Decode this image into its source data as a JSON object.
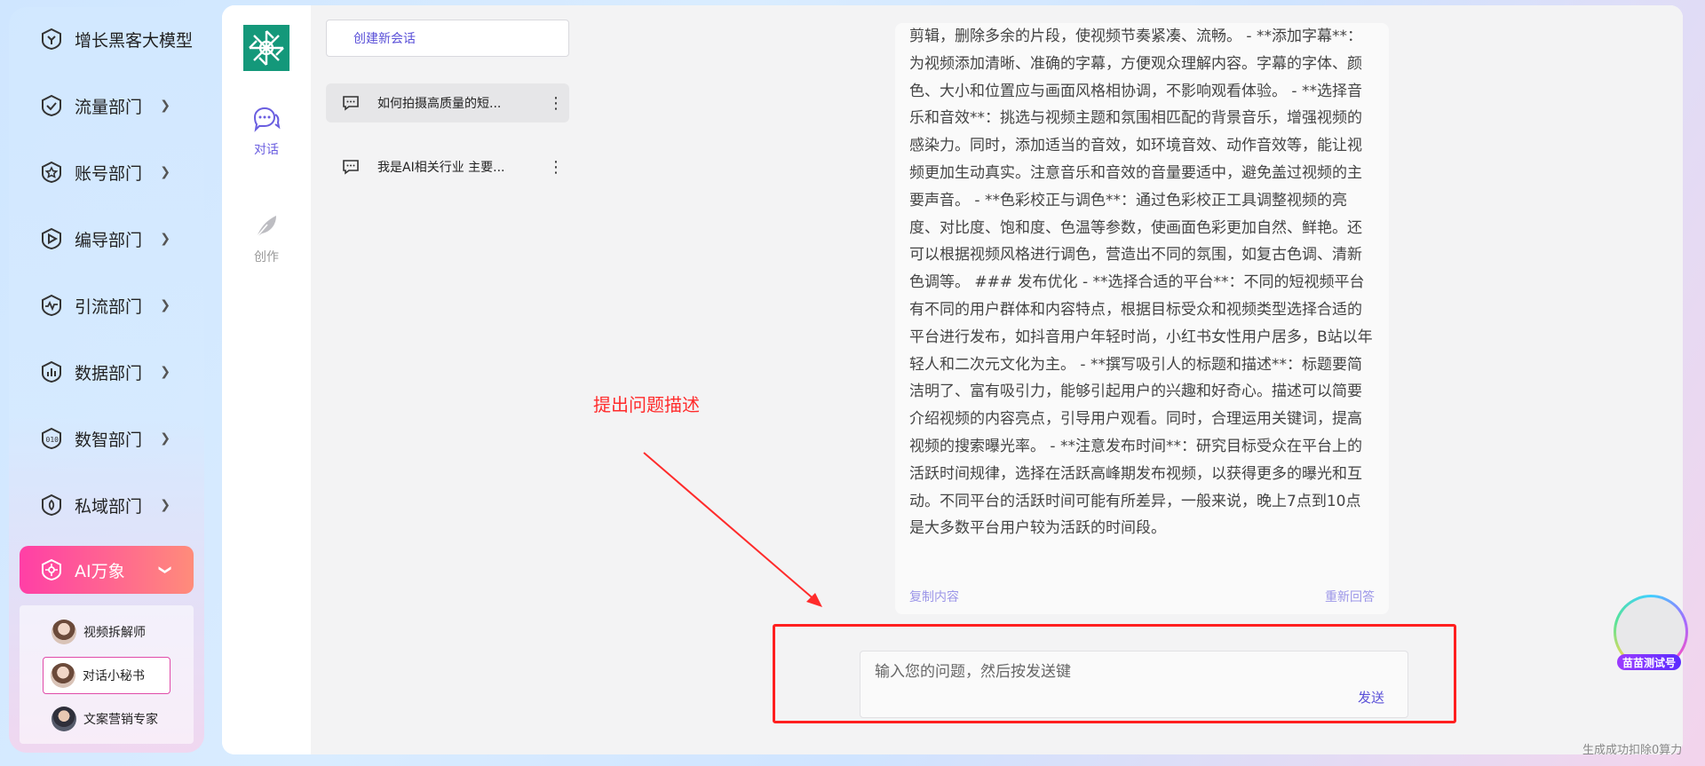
{
  "sidebar": {
    "brand": "增长黑客大模型",
    "items": [
      {
        "label": "流量部门",
        "icon": "shield-check-icon"
      },
      {
        "label": "账号部门",
        "icon": "shield-star-icon"
      },
      {
        "label": "编导部门",
        "icon": "shield-play-icon"
      },
      {
        "label": "引流部门",
        "icon": "shield-wave-icon"
      },
      {
        "label": "数据部门",
        "icon": "shield-chart-icon"
      },
      {
        "label": "数智部门",
        "icon": "shield-binary-icon"
      },
      {
        "label": "私域部门",
        "icon": "shield-lock-icon"
      }
    ],
    "active": {
      "label": "AI万象",
      "icon": "ai-flower-icon"
    },
    "subitems": [
      {
        "label": "视频拆解师"
      },
      {
        "label": "对话小秘书"
      },
      {
        "label": "文案营销专家"
      }
    ],
    "accent": "#ff3fa6"
  },
  "rail": {
    "chat": "对话",
    "create": "创作"
  },
  "sessions": {
    "new_label": "创建新会话",
    "list": [
      {
        "title": "如何拍摄高质量的短..."
      },
      {
        "title": "我是AI相关行业 主要..."
      }
    ]
  },
  "chat": {
    "answer": "剪辑，删除多余的片段，使视频节奏紧凑、流畅。 - **添加字幕**：为视频添加清晰、准确的字幕，方便观众理解内容。字幕的字体、颜色、大小和位置应与画面风格相协调，不影响观看体验。 - **选择音乐和音效**：挑选与视频主题和氛围相匹配的背景音乐，增强视频的感染力。同时，添加适当的音效，如环境音效、动作音效等，能让视频更加生动真实。注意音乐和音效的音量要适中，避免盖过视频的主要声音。 - **色彩校正与调色**：通过色彩校正工具调整视频的亮度、对比度、饱和度、色温等参数，使画面色彩更加自然、鲜艳。还可以根据视频风格进行调色，营造出不同的氛围，如复古色调、清新色调等。 ### 发布优化 - **选择合适的平台**：不同的短视频平台有不同的用户群体和内容特点，根据目标受众和视频类型选择合适的平台进行发布，如抖音用户年轻时尚，小红书女性用户居多，B站以年轻人和二次元文化为主。 - **撰写吸引人的标题和描述**：标题要简洁明了、富有吸引力，能够引起用户的兴趣和好奇心。描述可以简要介绍视频的内容亮点，引导用户观看。同时，合理运用关键词，提高视频的搜索曝光率。 - **注意发布时间**：研究目标受众在平台上的活跃时间规律，选择在活跃高峰期发布视频，以获得更多的曝光和互动。不同平台的活跃时间可能有所差异，一般来说，晚上7点到10点是大多数平台用户较为活跃的时间段。",
    "copy_label": "复制内容",
    "regen_label": "重新回答",
    "annotation": "提出问题描述",
    "input_placeholder": "输入您的问题，然后按发送键",
    "send_label": "发送"
  },
  "badge": {
    "label": "苗苗测试号"
  },
  "status": "生成成功扣除0算力"
}
